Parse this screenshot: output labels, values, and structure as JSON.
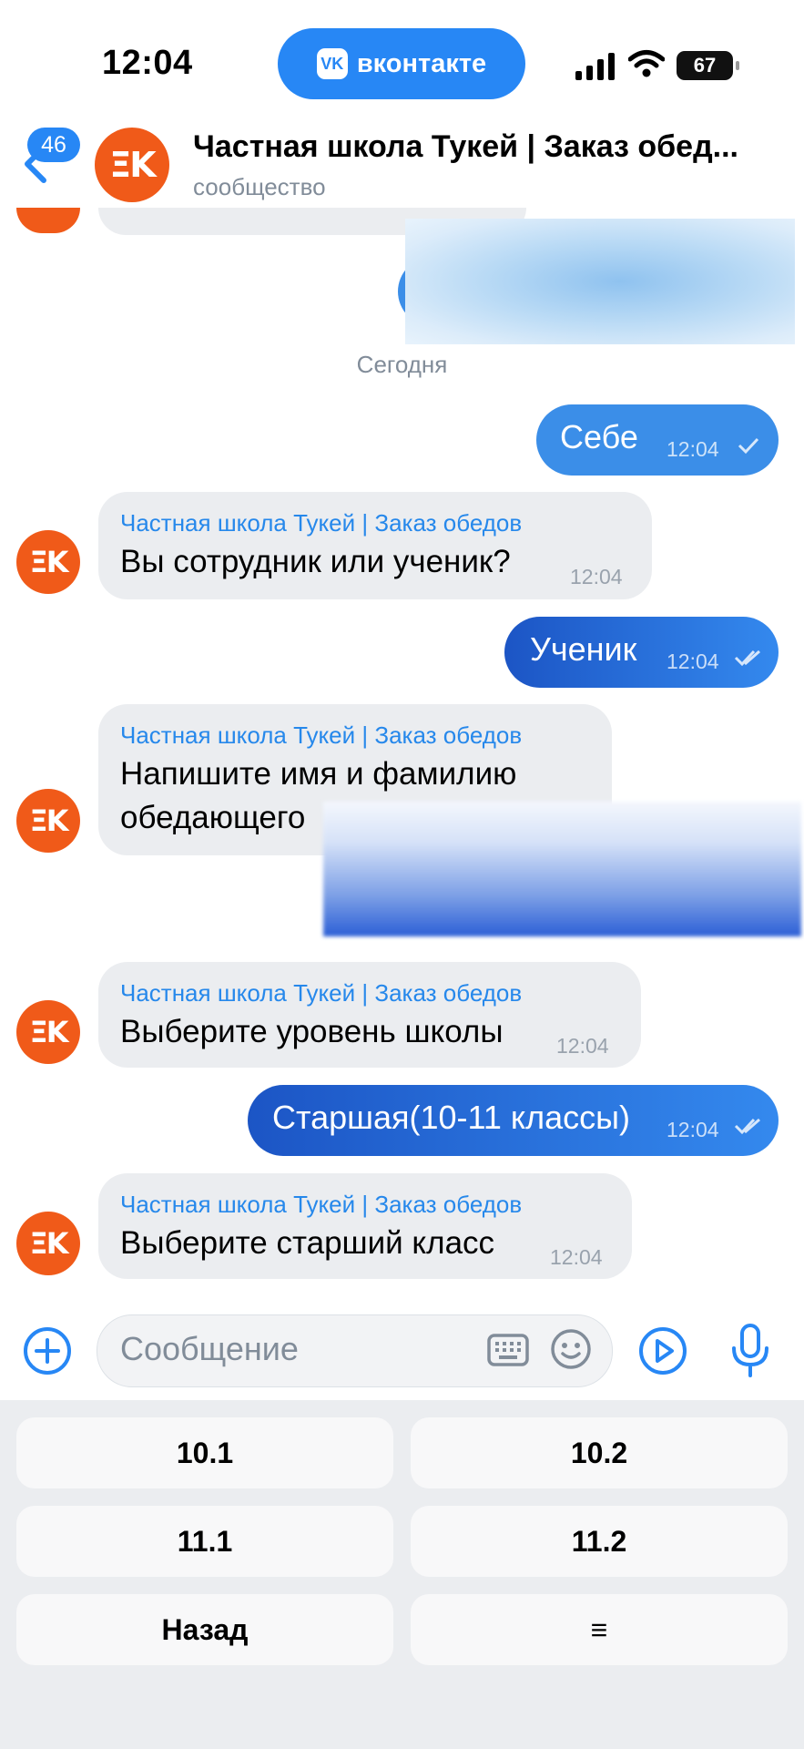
{
  "status_bar": {
    "time": "12:04",
    "app_pill": "вконтакте",
    "battery": "67"
  },
  "header": {
    "back_badge": "46",
    "avatar_text": "ΞK",
    "title": "Частная школа Тукей | Заказ обед...",
    "subtitle": "сообщество"
  },
  "chat": {
    "date_divider": "Сегодня",
    "messages": [
      {
        "text": "Себе",
        "time": "12:04"
      },
      {
        "sender": "Частная школа Тукей | Заказ обедов",
        "text": "Вы сотрудник или ученик?",
        "time": "12:04"
      },
      {
        "text": "Ученик",
        "time": "12:04"
      },
      {
        "sender": "Частная школа Тукей | Заказ обедов",
        "text_line1": "Напишите имя и фамилию",
        "text_line2": "обедающего"
      },
      {
        "sender": "Частная школа Тукей | Заказ обедов",
        "text": "Выберите уровень школы",
        "time": "12:04"
      },
      {
        "text": "Старшая(10-11 классы)",
        "time": "12:04"
      },
      {
        "sender": "Частная школа Тукей | Заказ обедов",
        "text": "Выберите старший класс",
        "time": "12:04"
      }
    ]
  },
  "composer": {
    "placeholder": "Сообщение"
  },
  "keyboard": {
    "buttons": [
      "10.1",
      "10.2",
      "11.1",
      "11.2",
      "Назад",
      "≡"
    ]
  },
  "colors": {
    "accent": "#2787f5",
    "avatar": "#f05a19",
    "bubble_in": "#ebedf0"
  }
}
